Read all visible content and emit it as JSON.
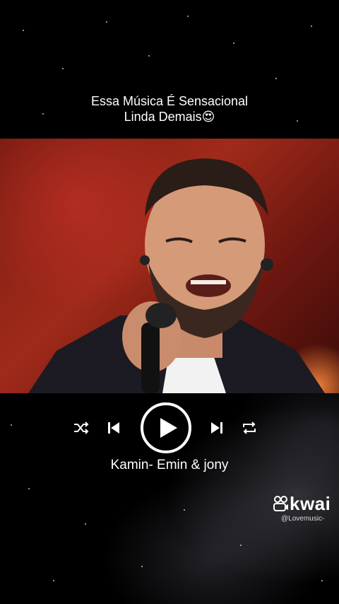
{
  "caption": {
    "line1": "Essa Música É Sensacional",
    "line2": "Linda Demais😍"
  },
  "player": {
    "state": "paused",
    "icons": [
      "shuffle-icon",
      "previous-icon",
      "play-icon",
      "next-icon",
      "repeat-icon"
    ],
    "song_title": "Kamin- Emin & jony"
  },
  "watermark": {
    "brand": "kwai",
    "handle": "@Lovemusic-"
  },
  "colors": {
    "background": "#000000",
    "text": "#ffffff",
    "stage_red": "#a02a1a"
  }
}
